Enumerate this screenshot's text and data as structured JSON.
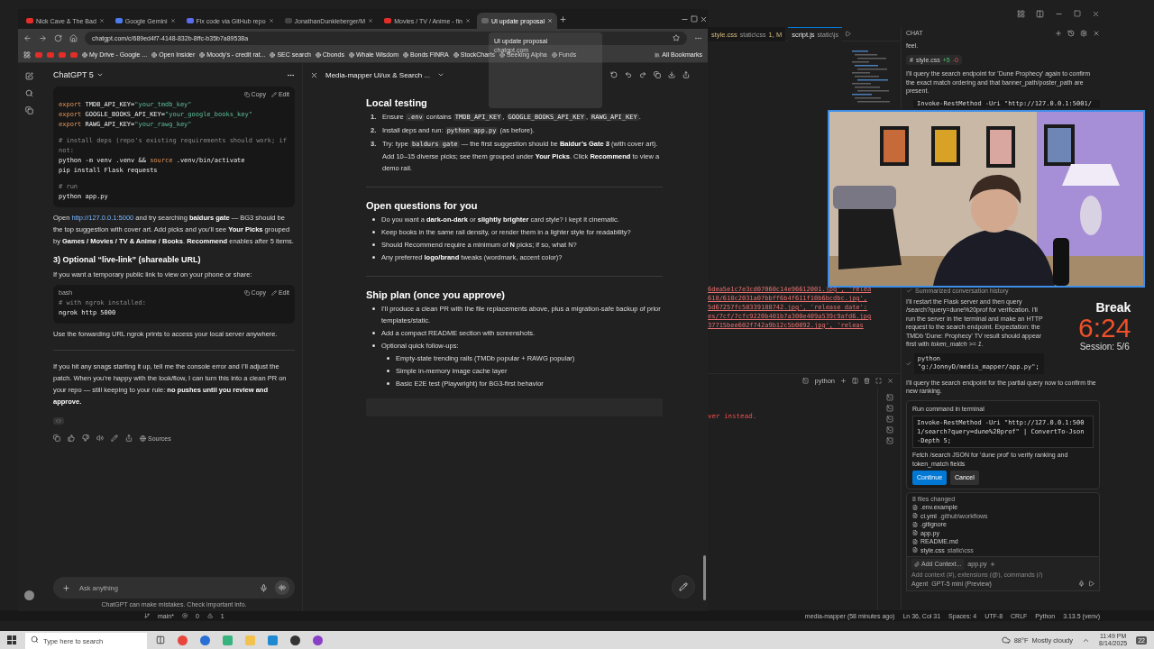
{
  "browser": {
    "tabs": [
      {
        "title": "Nick Cave & The Bad",
        "selected": false
      },
      {
        "title": "Google Gemini",
        "selected": false
      },
      {
        "title": "Fix code via GitHub repo",
        "selected": false
      },
      {
        "title": "JonathanDunkleberger/M",
        "selected": false
      },
      {
        "title": "Movies / TV / Anime - fin",
        "selected": false
      },
      {
        "title": "UI update proposal",
        "selected": true
      }
    ],
    "address": "chatgpt.com/c/689ed4f7-4148-832b-8ffc-b35b7a89538a",
    "bookmarks": [
      "My Drive - Google ...",
      "Open Insider",
      "Moody's - credit rat...",
      "SEC search",
      "Cbonds",
      "Whale Wisdom",
      "Bonds FINRA",
      "StockCharts",
      "Seeking Alpha",
      "Funds"
    ],
    "all_bookmarks": "All Bookmarks",
    "hover_card": {
      "title": "UI update proposal",
      "url": "chatgpt.com"
    }
  },
  "chat": {
    "model": "ChatGPT 5",
    "blocks": [
      {
        "kind": "code",
        "actions": [
          "Copy",
          "Edit"
        ],
        "lines": [
          {
            "kind": "code",
            "segs": [
              {
                "t": "export",
                "kind": "kw"
              },
              {
                "t": " TMDB_API_KEY=",
                "kind": "plain"
              },
              {
                "t": "\"your_tmdb_key\"",
                "kind": "str"
              }
            ]
          },
          {
            "kind": "code",
            "segs": [
              {
                "t": "export",
                "kind": "kw"
              },
              {
                "t": " GOOGLE_BOOKS_API_KEY=",
                "kind": "plain"
              },
              {
                "t": "\"your_google_books_key\"",
                "kind": "str"
              }
            ]
          },
          {
            "kind": "code",
            "segs": [
              {
                "t": "export",
                "kind": "kw"
              },
              {
                "t": " RAWG_API_KEY=",
                "kind": "plain"
              },
              {
                "t": "\"your_rawg_key\"",
                "kind": "str"
              }
            ]
          },
          {
            "kind": "blank"
          },
          {
            "kind": "code",
            "segs": [
              {
                "t": "# install deps (repo's existing requirements should work; if not:",
                "kind": "comment"
              }
            ]
          },
          {
            "kind": "code",
            "segs": [
              {
                "t": "python -m venv .venv && ",
                "kind": "plain"
              },
              {
                "t": "source",
                "kind": "kw"
              },
              {
                "t": " .venv/bin/activate",
                "kind": "plain"
              }
            ]
          },
          {
            "kind": "code",
            "segs": [
              {
                "t": "pip install Flask requests",
                "kind": "plain"
              }
            ]
          },
          {
            "kind": "blank"
          },
          {
            "kind": "code",
            "segs": [
              {
                "t": "# run",
                "kind": "comment"
              }
            ]
          },
          {
            "kind": "code",
            "segs": [
              {
                "t": "python app.py",
                "kind": "plain"
              }
            ]
          }
        ]
      },
      {
        "kind": "link_paragraph",
        "lead": "Open",
        "link": "http://127.0.0.1:5000",
        "text": "and try searching **baldurs gate** — BG3 should be the top suggestion with cover art. Add picks and you’ll see **Your Picks** grouped by **Games / Movies / TV & Anime / Books**. **Recommend** enables after 5 items."
      },
      {
        "kind": "heading",
        "text": "3) Optional “live-link” (shareable URL)"
      },
      {
        "kind": "paragraph",
        "text": "If you want a temporary public link to view on your phone or share:"
      },
      {
        "kind": "code",
        "lang": "bash",
        "actions": [
          "Copy",
          "Edit"
        ],
        "lines": [
          {
            "kind": "code",
            "segs": [
              {
                "t": "# with ngrok installed:",
                "kind": "comment"
              }
            ]
          },
          {
            "kind": "code",
            "segs": [
              {
                "t": "ngrok http 5000",
                "kind": "plain"
              }
            ]
          }
        ]
      },
      {
        "kind": "paragraph",
        "text": "Use the forwarding URL ngrok prints to access your local server anywhere."
      },
      {
        "kind": "divider"
      },
      {
        "kind": "paragraph",
        "text": "If you hit any snags starting it up, tell me the console error and I’ll adjust the patch. When you’re happy with the look/flow, I can turn this into a clean PR on your repo — still keeping to your rule: **no pushes until you review and approve.**"
      }
    ],
    "sources": "Sources",
    "placeholder": "Ask anything",
    "disclaimer": "ChatGPT can make mistakes. Check important info."
  },
  "canvas": {
    "title": "Media-mapper Ui/ux & Search ...",
    "sections": [
      {
        "heading": "Local testing",
        "items": [
          {
            "number": "1.",
            "segs": [
              {
                "t": "Ensure ",
                "code": false
              },
              {
                "t": ".env",
                "code": true
              },
              {
                "t": " contains ",
                "code": false
              },
              {
                "t": "TMDB_API_KEY",
                "code": true
              },
              {
                "t": ", ",
                "code": false
              },
              {
                "t": "GOOGLE_BOOKS_API_KEY",
                "code": true
              },
              {
                "t": ", ",
                "code": false
              },
              {
                "t": "RAWG_API_KEY",
                "code": true
              },
              {
                "t": ".",
                "code": false
              }
            ]
          },
          {
            "number": "2.",
            "segs": [
              {
                "t": "Install deps and run: ",
                "code": false
              },
              {
                "t": "python app.py",
                "code": true
              },
              {
                "t": " (as before).",
                "code": false
              }
            ]
          },
          {
            "number": "3.",
            "segs": [
              {
                "t": "Try: type ",
                "code": false
              },
              {
                "t": "baldurs gate",
                "code": true
              },
              {
                "t": " — the first suggestion should be **Baldur’s Gate 3** (with cover art). Add 10–15 diverse picks; see them grouped under **Your Picks**. Click **Recommend** to view a demo rail.",
                "code": false
              }
            ]
          }
        ]
      },
      {
        "heading": "Open questions for you",
        "items": [
          {
            "segs": [
              {
                "t": "Do you want a **dark-on-dark** or **slightly brighter** card style? I kept it cinematic.",
                "code": false
              }
            ]
          },
          {
            "segs": [
              {
                "t": "Keep books in the same rail density, or render them in a lighter style for readability?",
                "code": false
              }
            ]
          },
          {
            "segs": [
              {
                "t": "Should Recommend require a minimum of **N** picks; if so, what N?",
                "code": false
              }
            ]
          },
          {
            "segs": [
              {
                "t": "Any preferred **logo/brand** tweaks (wordmark, accent color)?",
                "code": false
              }
            ]
          }
        ]
      },
      {
        "heading": "Ship plan (once you approve)",
        "items": [
          {
            "segs": [
              {
                "t": "I’ll produce a clean PR with the file replacements above, plus a migration-safe backup of prior templates/static.",
                "code": false
              }
            ]
          },
          {
            "segs": [
              {
                "t": "Add a compact README section with screenshots.",
                "code": false
              }
            ]
          },
          {
            "segs": [
              {
                "t": "Optional quick follow-ups:",
                "code": false
              }
            ],
            "children": [
              {
                "segs": [
                  {
                    "t": "Empty-state trending rails (TMDb popular + RAWG popular)",
                    "code": false
                  }
                ]
              },
              {
                "segs": [
                  {
                    "t": "Simple in-memory image cache layer",
                    "code": false
                  }
                ]
              },
              {
                "segs": [
                  {
                    "t": "Basic E2E test (Playwright) for BG3-first behavior",
                    "code": false
                  }
                ]
              }
            ]
          }
        ]
      }
    ]
  },
  "vscode": {
    "editor_tabs": [
      {
        "name": "style.css",
        "path": "static\\css",
        "badge": "1, M",
        "selected": false
      },
      {
        "name": "script.js",
        "path": "static\\js",
        "selected": true
      }
    ],
    "terminal_output": [
      "6dea5e1c7e3cd07060c14e96612001.jpg', 'relea",
      "618/618c2031a07bbff6b4f611f10b6bcdbc.jpg',",
      "5d67257fc58339188742.jpg', 'release_date':",
      "es/7cf/7cfc9220b401b7a300e409a539c9afd6.jpg",
      "37715bee602f742a9b12c5b0892.jpg', 'releas"
    ],
    "terminal": {
      "shell": "python",
      "lines": [
        "ver instead."
      ]
    },
    "chat": {
      "header": "CHAT",
      "messages_top": [
        {
          "kind": "text",
          "text": "feel."
        },
        {
          "kind": "file_chip",
          "prefix": "#",
          "name": "style.css",
          "added": "+5",
          "removed": "-0"
        },
        {
          "kind": "text",
          "text": "I'll query the search endpoint for 'Dune Prophecy' again to confirm the exact match ordering and that banner_path/poster_path are present."
        },
        {
          "kind": "code",
          "text": "Invoke-RestMethod -Uri \"http://127.0.0.1:5001/"
        }
      ],
      "messages_bottom": [
        {
          "kind": "status",
          "text": "Summarized conversation history"
        },
        {
          "kind": "text",
          "text": "I'll restart the Flask server and then query /search?query=dune%20prof for verification. I'll run the server in the terminal and make an HTTP request to the search endpoint. Expectation: the TMDb 'Dune: Prophecy' TV result should appear first with *token_match >= 1*."
        },
        {
          "kind": "command",
          "text": "python \"g:/JonnyD/media_mapper/app.py\";"
        },
        {
          "kind": "text",
          "text": "I'll query the search endpoint for the partial query now to confirm the new ranking."
        },
        {
          "kind": "run_card",
          "title": "Run command in terminal",
          "code": "Invoke-RestMethod -Uri \"http://127.0.0.1:5001/search?query=dune%20prof\" | ConvertTo-Json -Depth 5;",
          "description": "Fetch /search JSON for 'dune prof' to verify ranking and token_match fields",
          "buttons": [
            "Continue",
            "Cancel"
          ]
        }
      ],
      "files_changed": {
        "title": "8 files changed",
        "files": [
          {
            "name": ".env.example"
          },
          {
            "name": "ci.yml",
            "path": ".github\\workflows"
          },
          {
            "name": ".gitignore"
          },
          {
            "name": "app.py"
          },
          {
            "name": "README.md"
          },
          {
            "name": "style.css",
            "path": "static\\css"
          }
        ]
      },
      "context_button": "Add Context...",
      "attached": "app.py",
      "placeholder": "Add context (#), extensions (@), commands (/)",
      "mode": "Agent",
      "model": "GPT-5 mini (Preview)"
    },
    "status_bar": {
      "branch": "main*",
      "errors": "0",
      "warnings": "1",
      "items": [
        "media-mapper (58 minutes ago)",
        "Ln 36, Col 31",
        "Spaces: 4",
        "UTF-8",
        "CRLF",
        "Python",
        "3.13.5 (venv)"
      ]
    }
  },
  "timer": {
    "label": "Break",
    "time": "6:24",
    "session": "Session: 5/6"
  },
  "taskbar": {
    "search_placeholder": "Type here to search",
    "temperature": "88°F",
    "weather": "Mostly cloudy",
    "time": "11:49 PM",
    "date": "8/14/2025",
    "notifications": "22"
  }
}
